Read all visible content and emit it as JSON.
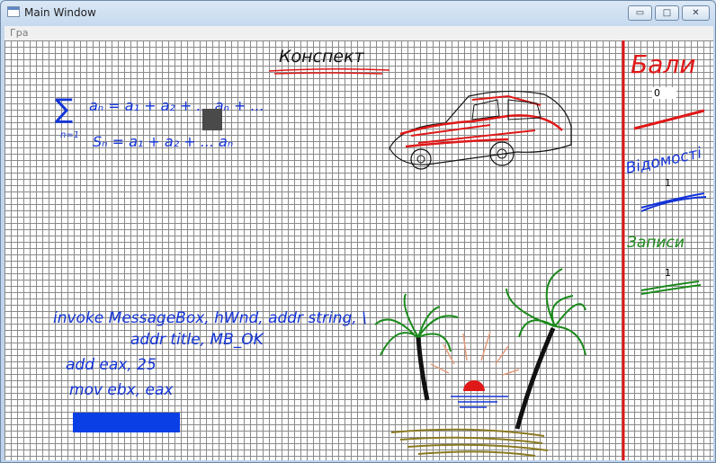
{
  "window": {
    "title": "Main Window",
    "controls": {
      "minimize": "▭",
      "maximize": "□",
      "close": "✕"
    }
  },
  "menu": {
    "items": [
      "Гра"
    ]
  },
  "board": {
    "heading": "Конспект",
    "series_line1": "aₙ = a₁ + a₂ + ... aₙ + ...",
    "series_line2": "Sₙ = a₁ + a₂ + ... aₙ",
    "sigma_index": "n=1",
    "code_lines": [
      "invoke MessageBox, hWnd, addr string, \\",
      "addr title, MB_OK",
      "add eax, 25",
      "mov ebx, eax"
    ]
  },
  "stats": {
    "points": {
      "label": "Бали",
      "value": "0"
    },
    "grades": {
      "label": "Відомості",
      "value": "1"
    },
    "notes": {
      "label": "Записи",
      "value": "1"
    }
  },
  "colors": {
    "red": "#e01818",
    "blue": "#1434d8",
    "green": "#1c8a1c",
    "brown": "#8a7a20",
    "grid": "#8a8a8a"
  }
}
